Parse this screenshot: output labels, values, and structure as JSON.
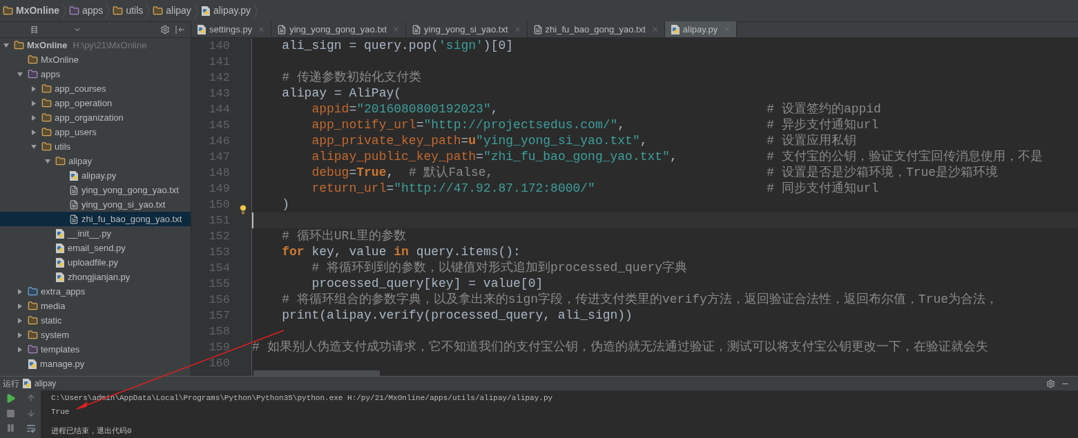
{
  "breadcrumb": [
    {
      "label": "MxOnline",
      "kind": "package"
    },
    {
      "label": "apps",
      "kind": "folder"
    },
    {
      "label": "utils",
      "kind": "package"
    },
    {
      "label": "alipay",
      "kind": "package"
    },
    {
      "label": "alipay.py",
      "kind": "python"
    }
  ],
  "project_panel": {
    "title": "目"
  },
  "tree": [
    {
      "label": "MxOnline",
      "path": "H:\\py\\21\\MxOnline",
      "kind": "package",
      "expanded": true,
      "selected": false,
      "children": [
        {
          "label": "MxOnline",
          "kind": "package",
          "selected": false
        },
        {
          "label": "apps",
          "kind": "folder",
          "expanded": true,
          "selected": false,
          "children": [
            {
              "label": "app_courses",
              "kind": "package",
              "expanded": false,
              "selected": false
            },
            {
              "label": "app_operation",
              "kind": "package",
              "expanded": false,
              "selected": false
            },
            {
              "label": "app_organization",
              "kind": "package",
              "expanded": false,
              "selected": false
            },
            {
              "label": "app_users",
              "kind": "package",
              "expanded": false,
              "selected": false
            },
            {
              "label": "utils",
              "kind": "package",
              "expanded": true,
              "selected": false,
              "children": [
                {
                  "label": "alipay",
                  "kind": "package",
                  "expanded": true,
                  "selected": false,
                  "children": [
                    {
                      "label": "alipay.py",
                      "kind": "python",
                      "selected": false
                    },
                    {
                      "label": "ying_yong_gong_yao.txt",
                      "kind": "text",
                      "selected": false
                    },
                    {
                      "label": "ying_yong_si_yao.txt",
                      "kind": "text",
                      "selected": false
                    },
                    {
                      "label": "zhi_fu_bao_gong_yao.txt",
                      "kind": "text",
                      "selected": true
                    }
                  ]
                },
                {
                  "label": "__init__.py",
                  "kind": "python",
                  "selected": false
                },
                {
                  "label": "email_send.py",
                  "kind": "python",
                  "selected": false
                },
                {
                  "label": "uploadfile.py",
                  "kind": "python",
                  "selected": false
                },
                {
                  "label": "zhongjianjan.py",
                  "kind": "python",
                  "selected": false
                }
              ]
            }
          ]
        },
        {
          "label": "extra_apps",
          "kind": "source",
          "expanded": false,
          "selected": false
        },
        {
          "label": "media",
          "kind": "package",
          "expanded": false,
          "selected": false
        },
        {
          "label": "static",
          "kind": "package",
          "expanded": false,
          "selected": false
        },
        {
          "label": "system",
          "kind": "package",
          "expanded": false,
          "selected": false
        },
        {
          "label": "templates",
          "kind": "folder",
          "expanded": false,
          "selected": false
        },
        {
          "label": "manage.py",
          "kind": "python",
          "selected": false
        }
      ]
    }
  ],
  "tabs": [
    {
      "label": "settings.py",
      "kind": "python",
      "selected": false
    },
    {
      "label": "ying_yong_gong_yao.txt",
      "kind": "text",
      "selected": false
    },
    {
      "label": "ying_yong_si_yao.txt",
      "kind": "text",
      "selected": false
    },
    {
      "label": "zhi_fu_bao_gong_yao.txt",
      "kind": "text",
      "selected": false
    },
    {
      "label": "alipay.py",
      "kind": "python",
      "selected": true
    }
  ],
  "code_lines": [
    {
      "number": "140",
      "tokens": [
        {
          "kind": "plain",
          "text": "    ali_sign = query.pop("
        },
        {
          "kind": "string",
          "text": "'sign'"
        },
        {
          "kind": "plain",
          "text": ")[0]"
        }
      ]
    },
    {
      "number": "141"
    },
    {
      "number": "142",
      "tokens": [
        {
          "kind": "comment",
          "text": "    # 传递参数初始化支付类"
        }
      ]
    },
    {
      "number": "143",
      "tokens": [
        {
          "kind": "plain",
          "text": "    alipay = AliPay("
        }
      ]
    },
    {
      "number": "144",
      "tokens": [
        {
          "kind": "param",
          "text": "        appid"
        },
        {
          "kind": "plain",
          "text": "="
        },
        {
          "kind": "string",
          "text": "\"2016080800192023\""
        },
        {
          "kind": "plain",
          "text": ","
        }
      ],
      "comment": "# 设置签约的appid"
    },
    {
      "number": "145",
      "tokens": [
        {
          "kind": "param",
          "text": "        app_notify_url"
        },
        {
          "kind": "plain",
          "text": "="
        },
        {
          "kind": "string",
          "text": "\"http://projectsedus.com/\""
        },
        {
          "kind": "plain",
          "text": ","
        }
      ],
      "comment": "# 异步支付通知url"
    },
    {
      "number": "146",
      "tokens": [
        {
          "kind": "param",
          "text": "        app_private_key_path"
        },
        {
          "kind": "plain",
          "text": "="
        },
        {
          "kind": "keyword",
          "text": "u"
        },
        {
          "kind": "string",
          "text": "\"ying_yong_si_yao.txt\""
        },
        {
          "kind": "plain",
          "text": ","
        }
      ],
      "comment": "# 设置应用私钥"
    },
    {
      "number": "147",
      "tokens": [
        {
          "kind": "param",
          "text": "        alipay_public_key_path"
        },
        {
          "kind": "plain",
          "text": "="
        },
        {
          "kind": "string",
          "text": "\"zhi_fu_bao_gong_yao.txt\""
        },
        {
          "kind": "plain",
          "text": ","
        }
      ],
      "comment": "# 支付宝的公钥，验证支付宝回传消息使用，不是"
    },
    {
      "number": "148",
      "tokens": [
        {
          "kind": "param",
          "text": "        debug"
        },
        {
          "kind": "plain",
          "text": "="
        },
        {
          "kind": "keyword",
          "text": "True"
        },
        {
          "kind": "plain",
          "text": ",  "
        },
        {
          "kind": "comment",
          "text": "# 默认False,"
        }
      ],
      "comment": "# 设置是否是沙箱环境，True是沙箱环境"
    },
    {
      "number": "149",
      "tokens": [
        {
          "kind": "param",
          "text": "        return_url"
        },
        {
          "kind": "plain",
          "text": "="
        },
        {
          "kind": "string",
          "text": "\"http://47.92.87.172:8000/\""
        }
      ],
      "comment": "# 同步支付通知url"
    },
    {
      "number": "150",
      "tokens": [
        {
          "kind": "plain",
          "text": "    )"
        }
      ]
    },
    {
      "number": "151",
      "current": true
    },
    {
      "number": "152",
      "tokens": [
        {
          "kind": "comment",
          "text": "    # 循环出URL里的参数"
        }
      ]
    },
    {
      "number": "153",
      "tokens": [
        {
          "kind": "keyword",
          "text": "    for"
        },
        {
          "kind": "plain",
          "text": " key, value "
        },
        {
          "kind": "keyword",
          "text": "in"
        },
        {
          "kind": "plain",
          "text": " query.items():"
        }
      ]
    },
    {
      "number": "154",
      "tokens": [
        {
          "kind": "comment",
          "text": "        # 将循环到到的参数，以键值对形式追加到processed_query字典"
        }
      ]
    },
    {
      "number": "155",
      "tokens": [
        {
          "kind": "plain",
          "text": "        processed_query[key] = value[0]"
        }
      ]
    },
    {
      "number": "156",
      "tokens": [
        {
          "kind": "comment",
          "text": "    # 将循环组合的参数字典，以及拿出来的sign字段，传进支付类里的verify方法，返回验证合法性，返回布尔值，True为合法，"
        }
      ]
    },
    {
      "number": "157",
      "tokens": [
        {
          "kind": "plain",
          "text": "    print(alipay.verify(processed_query, ali_sign))"
        }
      ]
    },
    {
      "number": "158"
    },
    {
      "number": "159",
      "tokens": [
        {
          "kind": "comment",
          "text": "# 如果别人伪造支付成功请求，它不知道我们的支付宝公钥，伪造的就无法通过验证，测试可以将支付宝公钥更改一下，在验证就会失"
        }
      ]
    },
    {
      "number": "160"
    }
  ],
  "run_panel": {
    "label": "运行",
    "config": "alipay",
    "output": [
      "C:\\Users\\admin\\AppData\\Local\\Programs\\Python\\Python35\\python.exe H:/py/21/MxOnline/apps/utils/alipay/alipay.py",
      "True",
      "进程已结束，退出代码0"
    ]
  }
}
